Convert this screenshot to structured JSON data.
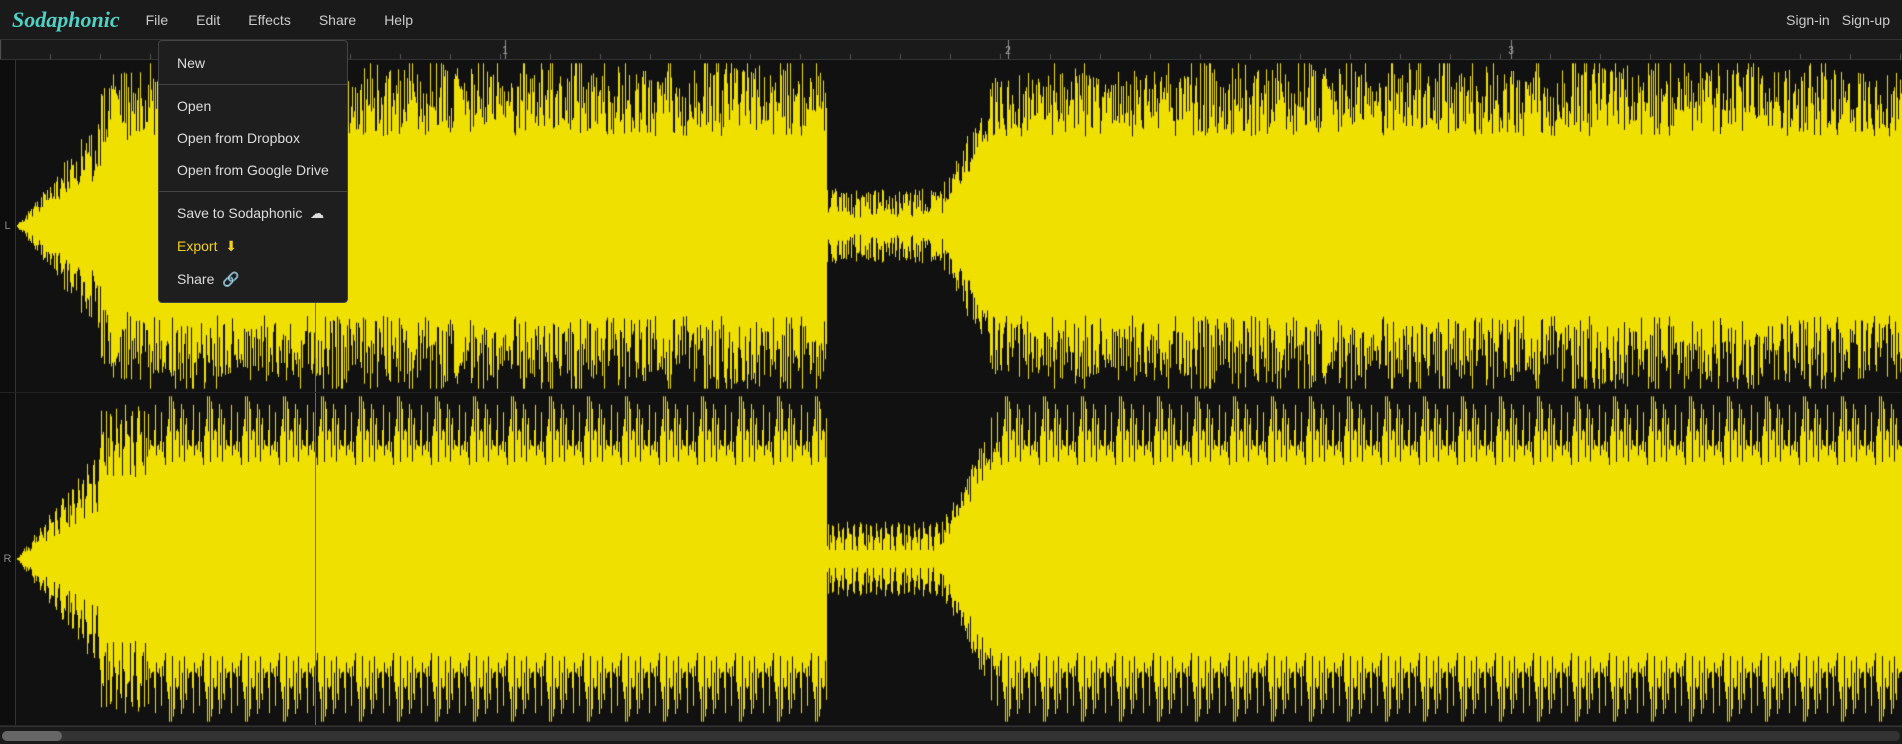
{
  "app": {
    "logo": "Sodaphonic"
  },
  "navbar": {
    "menu_items": [
      {
        "label": "File",
        "id": "file"
      },
      {
        "label": "Edit",
        "id": "edit"
      },
      {
        "label": "Effects",
        "id": "effects"
      },
      {
        "label": "Share",
        "id": "share"
      },
      {
        "label": "Help",
        "id": "help"
      }
    ],
    "right_links": [
      {
        "label": "Sign-in"
      },
      {
        "label": "Sign-up"
      }
    ]
  },
  "file_dropdown": {
    "items": [
      {
        "label": "New",
        "icon": "",
        "type": "item"
      },
      {
        "type": "divider"
      },
      {
        "label": "Open",
        "icon": "",
        "type": "item"
      },
      {
        "label": "Open from Dropbox",
        "icon": "",
        "type": "item"
      },
      {
        "label": "Open from Google Drive",
        "icon": "",
        "type": "item"
      },
      {
        "type": "divider"
      },
      {
        "label": "Save to Sodaphonic",
        "icon": "☁",
        "type": "item"
      },
      {
        "label": "Export",
        "icon": "⬇",
        "type": "item",
        "highlighted": true
      },
      {
        "label": "Share",
        "icon": "🔗",
        "type": "item"
      }
    ]
  },
  "waveform": {
    "color": "#f0e000",
    "background": "#111",
    "channels": [
      "L",
      "R"
    ],
    "playhead_color": "#cc0000",
    "ruler_marks": [
      {
        "pos": 505,
        "label": "1"
      },
      {
        "pos": 1008,
        "label": "2"
      },
      {
        "pos": 1511,
        "label": "3"
      }
    ]
  },
  "scrollbar": {
    "position": 0
  }
}
